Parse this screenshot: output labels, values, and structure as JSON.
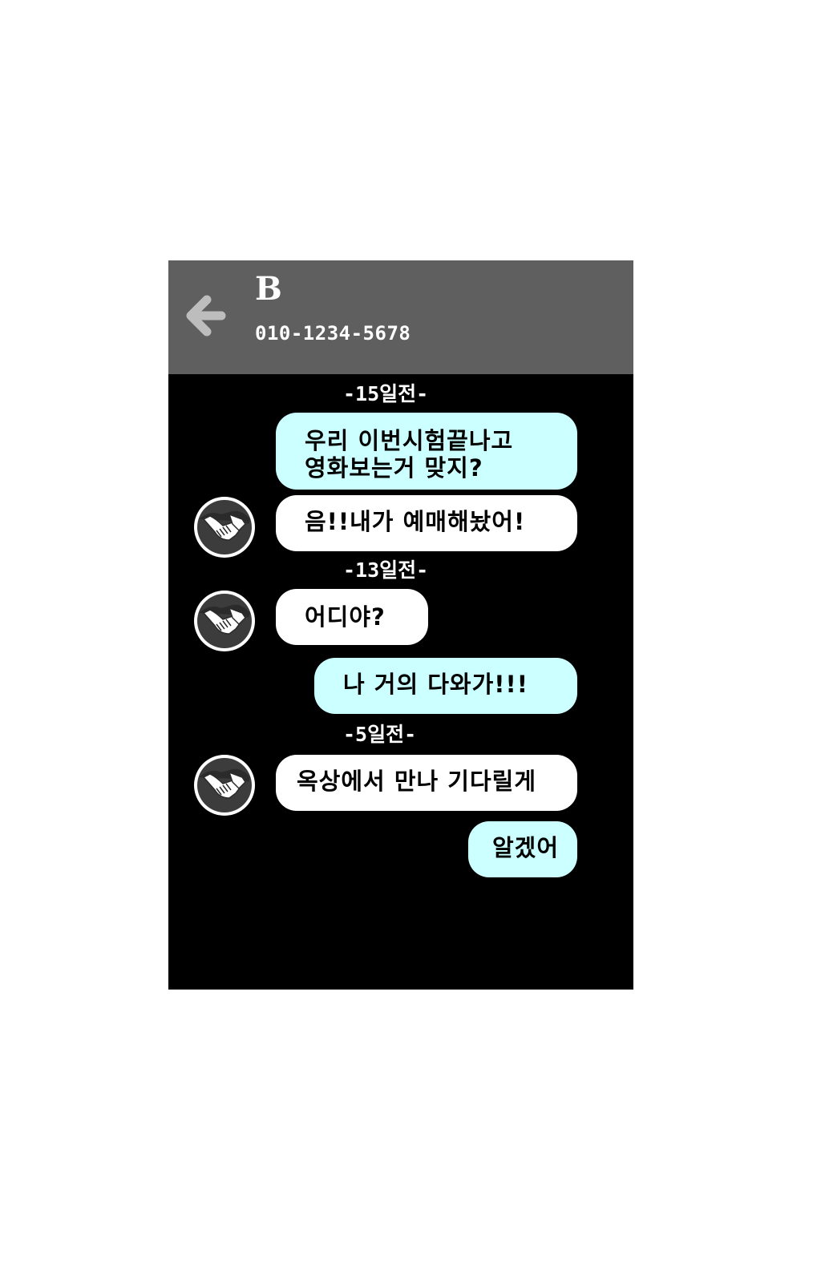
{
  "header": {
    "back_icon": "arrow-left-icon",
    "contact_name": "B",
    "contact_phone": "010-1234-5678",
    "background_color": "#5f5f5f"
  },
  "chat": {
    "background_color": "#000000",
    "sent_bubble_color": "#ccffff",
    "received_bubble_color": "#ffffff",
    "avatar_icon": "handshake-icon",
    "date_separators": [
      "-15일전-",
      "-13일전-",
      "-5일전-"
    ],
    "messages": [
      {
        "direction": "sent",
        "lines": [
          "우리 이번시험끝나고",
          "영화보는거 맞지?"
        ]
      },
      {
        "direction": "received",
        "lines": [
          "음!!내가 예매해놨어!"
        ]
      },
      {
        "direction": "received",
        "lines": [
          "어디야?"
        ]
      },
      {
        "direction": "sent",
        "lines": [
          "나 거의 다와가!!!"
        ]
      },
      {
        "direction": "received",
        "lines": [
          "옥상에서 만나 기다릴게"
        ]
      },
      {
        "direction": "sent",
        "lines": [
          "알겠어"
        ]
      }
    ]
  }
}
